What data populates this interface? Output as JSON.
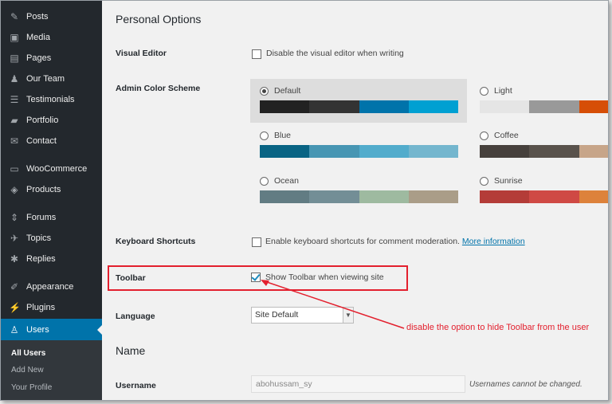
{
  "sidebar": {
    "items": [
      {
        "label": "Posts",
        "icon": "pushpin-icon"
      },
      {
        "label": "Media",
        "icon": "media-icon"
      },
      {
        "label": "Pages",
        "icon": "pages-icon"
      },
      {
        "label": "Our Team",
        "icon": "team-icon"
      },
      {
        "label": "Testimonials",
        "icon": "testimonials-icon"
      },
      {
        "label": "Portfolio",
        "icon": "folder-icon"
      },
      {
        "label": "Contact",
        "icon": "envelope-icon"
      },
      {
        "label": "WooCommerce",
        "icon": "woocommerce-icon"
      },
      {
        "label": "Products",
        "icon": "box-icon"
      },
      {
        "label": "Forums",
        "icon": "forums-icon"
      },
      {
        "label": "Topics",
        "icon": "topics-icon"
      },
      {
        "label": "Replies",
        "icon": "replies-icon"
      },
      {
        "label": "Appearance",
        "icon": "paintbrush-icon"
      },
      {
        "label": "Plugins",
        "icon": "plug-icon"
      },
      {
        "label": "Users",
        "icon": "users-icon"
      }
    ],
    "submenu": [
      "All Users",
      "Add New",
      "Your Profile"
    ]
  },
  "main": {
    "section_title": "Personal Options",
    "visual_editor": {
      "label": "Visual Editor",
      "checkbox_label": "Disable the visual editor when writing"
    },
    "color_scheme": {
      "label": "Admin Color Scheme",
      "schemes": [
        {
          "name": "Default",
          "selected": true,
          "colors": [
            "#222222",
            "#333333",
            "#0073aa",
            "#00a0d2"
          ]
        },
        {
          "name": "Light",
          "selected": false,
          "colors": [
            "#e5e5e5",
            "#999999",
            "#d64e07",
            "#04a4cc"
          ]
        },
        {
          "name": "Blue",
          "selected": false,
          "colors": [
            "#096484",
            "#4796b3",
            "#52accc",
            "#74b6ce"
          ]
        },
        {
          "name": "Coffee",
          "selected": false,
          "colors": [
            "#46403c",
            "#59524c",
            "#c7a589",
            "#9ea476"
          ]
        },
        {
          "name": "Ocean",
          "selected": false,
          "colors": [
            "#627c83",
            "#738e96",
            "#9ebaa0",
            "#aa9d88"
          ]
        },
        {
          "name": "Sunrise",
          "selected": false,
          "colors": [
            "#b43c38",
            "#cf4944",
            "#dd823b",
            "#ccaf0b"
          ]
        }
      ]
    },
    "keyboard_shortcuts": {
      "label": "Keyboard Shortcuts",
      "checkbox_label": "Enable keyboard shortcuts for comment moderation.",
      "link": "More information"
    },
    "toolbar": {
      "label": "Toolbar",
      "checkbox_label": "Show Toolbar when viewing site",
      "checked": true
    },
    "language": {
      "label": "Language",
      "value": "Site Default"
    },
    "name_section_title": "Name",
    "username": {
      "label": "Username",
      "value": "abohussam_sy",
      "description": "Usernames cannot be changed."
    }
  },
  "annotation": {
    "text": "disable the option to hide Toolbar from the user",
    "color": "#e3202e"
  }
}
